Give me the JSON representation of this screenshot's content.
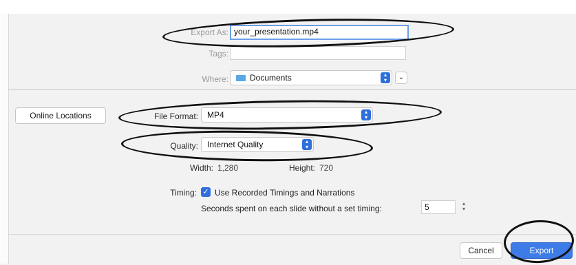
{
  "export_as": {
    "label": "Export As:",
    "value": "your_presentation.mp4"
  },
  "tags": {
    "label": "Tags:",
    "value": ""
  },
  "where": {
    "label": "Where:",
    "value": "Documents",
    "expand_icon": "chevron-down-icon"
  },
  "online_locations": {
    "label": "Online Locations"
  },
  "file_format": {
    "label": "File Format:",
    "value": "MP4"
  },
  "quality": {
    "label": "Quality:",
    "value": "Internet Quality"
  },
  "dimensions": {
    "width_label": "Width:",
    "width": "1,280",
    "height_label": "Height:",
    "height": "720"
  },
  "timing": {
    "label": "Timing:",
    "checkbox_label": "Use Recorded Timings and Narrations",
    "checked": true,
    "seconds_label": "Seconds spent on each slide without a set timing:",
    "seconds_value": "5"
  },
  "buttons": {
    "cancel": "Cancel",
    "export": "Export"
  },
  "colors": {
    "accent": "#3d7be6",
    "annotation": "#111111"
  }
}
